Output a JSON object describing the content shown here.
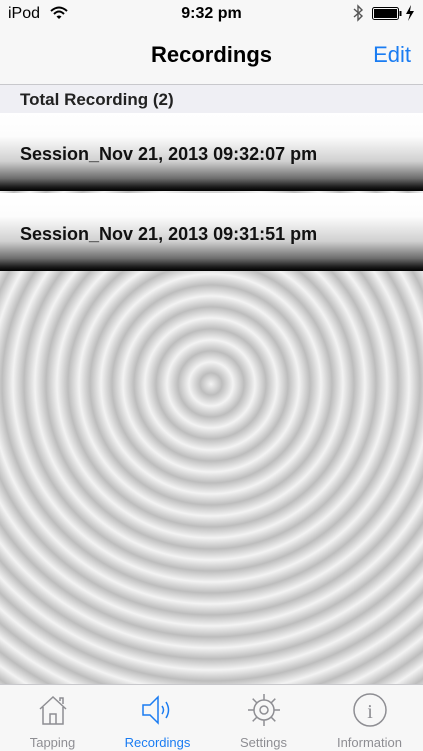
{
  "status": {
    "carrier": "iPod",
    "time": "9:32 pm"
  },
  "nav": {
    "title": "Recordings",
    "edit": "Edit"
  },
  "section": {
    "header": "Total Recording (2)"
  },
  "recordings": [
    {
      "name": "Session_Nov 21, 2013 09:32:07 pm"
    },
    {
      "name": "Session_Nov 21, 2013 09:31:51 pm"
    }
  ],
  "tabs": [
    {
      "label": "Tapping",
      "icon": "house-icon"
    },
    {
      "label": "Recordings",
      "icon": "speaker-icon",
      "active": true
    },
    {
      "label": "Settings",
      "icon": "gear-icon"
    },
    {
      "label": "Information",
      "icon": "info-icon"
    }
  ],
  "colors": {
    "accent": "#1a7cf2",
    "inactive": "#8e8e93"
  }
}
